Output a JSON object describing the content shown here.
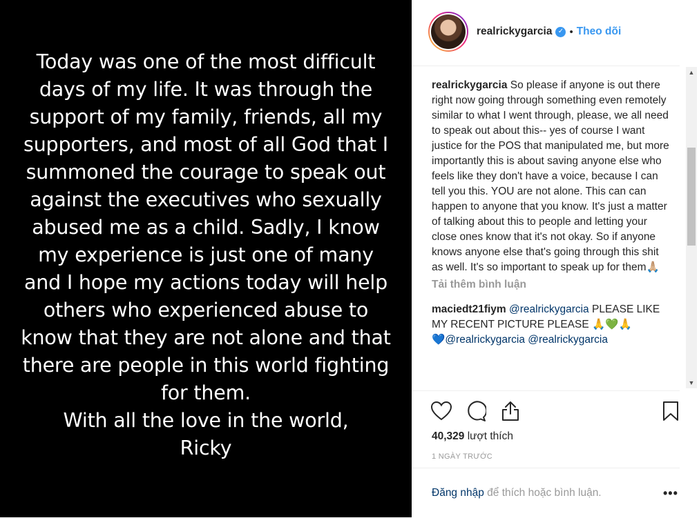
{
  "media": {
    "text": "Today was one of the most difficult\ndays of my life. It was through the\nsupport of my family, friends, all my\nsupporters, and most of all God that I\nsummoned the courage to speak out\nagainst the executives who sexually\nabused me as a child. Sadly, I know\nmy experience is just one of many\nand I hope my actions today will help\nothers who experienced abuse to\nknow that they are not alone and that\nthere are people in this world fighting\nfor them.\nWith all the love in the world,\nRicky"
  },
  "header": {
    "username": "realrickygarcia",
    "separator": "•",
    "follow_label": "Theo dõi",
    "verified_icon": "verified-check-icon"
  },
  "comments": [
    {
      "user": "realrickygarcia",
      "text": "So please if anyone is out there right now going through something even remotely similar to what I went through, please, we all need to speak out about this-- yes of course I want justice for the POS that manipulated me, but more importantly this is about saving anyone else who feels like they don't have a voice, because I can tell you this. YOU are not alone. This can can happen to anyone that you know. It's just a matter of talking about this to people and letting your close ones know that it's not okay. So if anyone knows anyone else that's going through this shit as well. It's so important to speak up for them🙏🏼"
    },
    {
      "user": "maciedt21fiym",
      "mention": "@realrickygarcia",
      "text": "PLEASE LIKE MY RECENT PICTURE PLEASE 🙏💚🙏",
      "line2_emoji": "💙",
      "mention2": "@realrickygarcia",
      "mention3": "@realrickygarcia"
    }
  ],
  "load_more_label": "Tải thêm bình luận",
  "likes": {
    "count": "40,329",
    "label": "lượt thích"
  },
  "timestamp": "1 NGÀY TRƯỚC",
  "login": {
    "link": "Đăng nhập",
    "text": "để thích hoặc bình luận."
  },
  "more_label": "•••",
  "icons": {
    "like": "heart-icon",
    "comment": "comment-icon",
    "share": "share-icon",
    "save": "bookmark-icon"
  },
  "colors": {
    "accent": "#3897f0",
    "link": "#003569",
    "muted": "#999999",
    "text": "#262626",
    "media_bg": "#000000"
  }
}
